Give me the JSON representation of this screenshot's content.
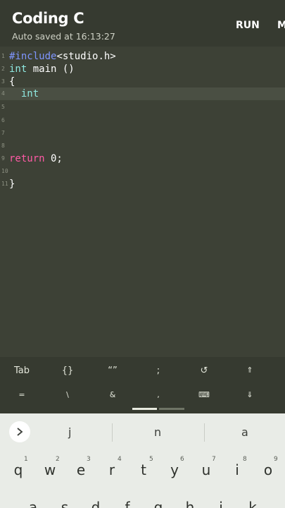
{
  "header": {
    "title": "Coding C",
    "subtitle": "Auto saved at 16:13:27",
    "run_label": "RUN",
    "more_label": "M"
  },
  "editor": {
    "lines": [
      {
        "num": "1",
        "tokens": [
          {
            "t": "#include",
            "c": "pre"
          },
          {
            "t": "<studio.h>",
            "c": "plain"
          }
        ]
      },
      {
        "num": "2",
        "tokens": [
          {
            "t": "int",
            "c": "kw"
          },
          {
            "t": " main ()",
            "c": "plain"
          }
        ]
      },
      {
        "num": "3",
        "tokens": [
          {
            "t": "{",
            "c": "plain"
          }
        ]
      },
      {
        "num": "4",
        "tokens": [
          {
            "t": "  int",
            "c": "kw"
          }
        ],
        "active": true
      },
      {
        "num": "5",
        "tokens": []
      },
      {
        "num": "6",
        "tokens": []
      },
      {
        "num": "7",
        "tokens": []
      },
      {
        "num": "8",
        "tokens": []
      },
      {
        "num": "9",
        "tokens": [
          {
            "t": "return",
            "c": "ret"
          },
          {
            "t": " 0;",
            "c": "plain"
          }
        ]
      },
      {
        "num": "10",
        "tokens": []
      },
      {
        "num": "11",
        "tokens": [
          {
            "t": "}",
            "c": "plain"
          }
        ]
      }
    ]
  },
  "symbols": {
    "row1": [
      "Tab",
      "{}",
      "“”",
      ";",
      "↺",
      "⇑"
    ],
    "row2": [
      "=",
      "\\",
      "&",
      ",",
      "⌨",
      "⇓"
    ]
  },
  "keyboard": {
    "suggestions": [
      "j",
      "n",
      "a"
    ],
    "row1": [
      {
        "k": "q",
        "h": "1"
      },
      {
        "k": "w",
        "h": "2"
      },
      {
        "k": "e",
        "h": "3"
      },
      {
        "k": "r",
        "h": "4"
      },
      {
        "k": "t",
        "h": "5"
      },
      {
        "k": "y",
        "h": "6"
      },
      {
        "k": "u",
        "h": "7"
      },
      {
        "k": "i",
        "h": "8"
      },
      {
        "k": "o",
        "h": "9"
      }
    ],
    "row2": [
      "a",
      "s",
      "d",
      "f",
      "g",
      "h",
      "j",
      "k"
    ]
  },
  "colors": {
    "editor_bg": "#3d4136",
    "preprocessor": "#7f96ff",
    "keyword": "#8fe8e0",
    "return_keyword": "#ff5aa5"
  }
}
